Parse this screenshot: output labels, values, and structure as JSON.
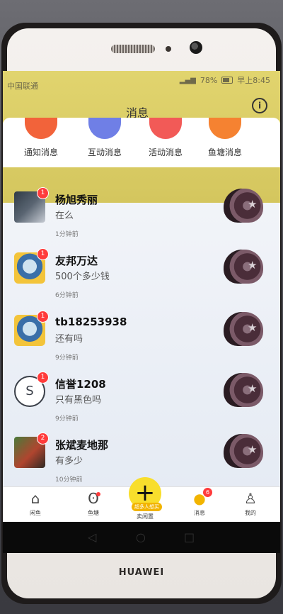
{
  "status_bar": {
    "carrier": "中国联通",
    "battery": "78%",
    "time": "早上8:45"
  },
  "header": {
    "title": "消息"
  },
  "categories": [
    {
      "label": "通知消息",
      "color": "#f2633a"
    },
    {
      "label": "互动消息",
      "color": "#6f7fe6"
    },
    {
      "label": "活动消息",
      "color": "#f25a57"
    },
    {
      "label": "鱼塘消息",
      "color": "#f58231"
    }
  ],
  "messages": [
    {
      "name": "杨旭秀丽",
      "text": "在么",
      "time": "1分钟前",
      "badge": "1"
    },
    {
      "name": "友邦万达",
      "text": "500个多少钱",
      "time": "6分钟前",
      "badge": "1"
    },
    {
      "name": "tb18253938",
      "text": "还有吗",
      "time": "9分钟前",
      "badge": "1"
    },
    {
      "name": "信誉1208",
      "text": "只有黑色吗",
      "time": "9分钟前",
      "badge": "1"
    },
    {
      "name": "张斌麦地那",
      "text": "有多少",
      "time": "10分钟前",
      "badge": "2"
    }
  ],
  "bottom_nav": {
    "home": "闲鱼",
    "fishpond": "鱼塘",
    "publish": "卖闲置",
    "publish_tag": "超多人想买",
    "messages": "消息",
    "messages_badge": "6",
    "mine": "我的"
  },
  "device": {
    "brand": "HUAWEI"
  },
  "colors": {
    "accent": "#f8de2c",
    "badge": "#ff3b3b"
  }
}
